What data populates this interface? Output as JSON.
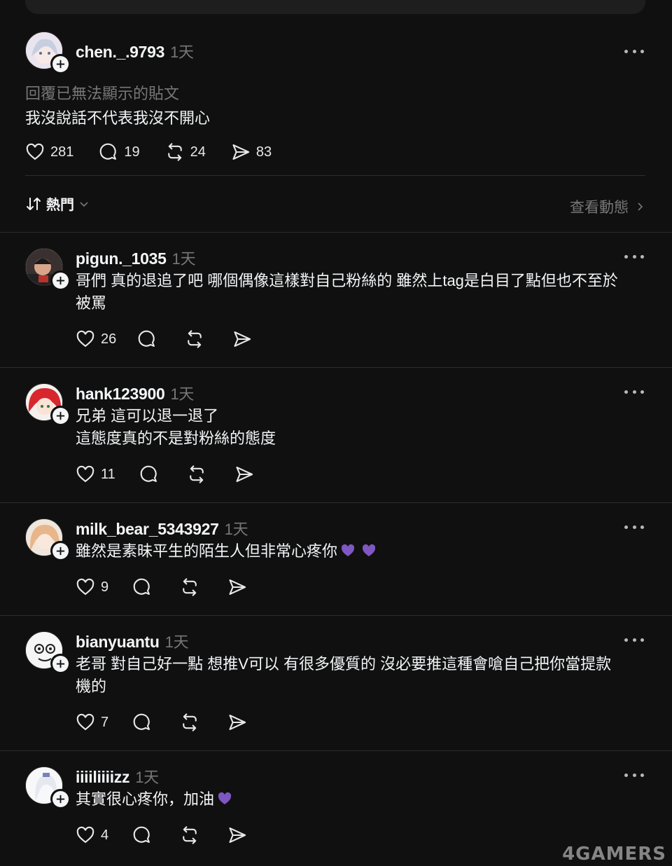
{
  "main_post": {
    "username": "chen._.9793",
    "time": "1天",
    "reply_notice": "回覆已無法顯示的貼文",
    "text": "我沒說話不代表我沒不開心",
    "likes": "281",
    "comments": "19",
    "reposts": "24",
    "shares": "83"
  },
  "sort_bar": {
    "label": "熱門",
    "activity_link": "查看動態"
  },
  "replies": [
    {
      "username": "pigun._1035",
      "time": "1天",
      "text_line1": "哥們 真的退追了吧 哪個偶像這樣對自己粉絲的 雖然上tag是白目了點但也不至於",
      "text_line2": "被罵",
      "likes": "26"
    },
    {
      "username": "hank123900",
      "time": "1天",
      "text_line1": "兄弟 這可以退一退了",
      "text_line2": "這態度真的不是對粉絲的態度",
      "likes": "11"
    },
    {
      "username": "milk_bear_5343927",
      "time": "1天",
      "text_line1": "雖然是素昧平生的陌生人但非常心疼你",
      "likes": "9"
    },
    {
      "username": "bianyuantu",
      "time": "1天",
      "text_line1": "老哥 對自己好一點 想推V可以 有很多優質的 沒必要推這種會嗆自己把你當提款",
      "text_line2": "機的",
      "likes": "7"
    },
    {
      "username": "iiiiliiiizz",
      "time": "1天",
      "text_line1": "其實很心疼你，加油",
      "likes": "4"
    }
  ],
  "watermark": "4GAMERS",
  "colors": {
    "background": "#101010",
    "text_primary": "#f3f5f7",
    "text_secondary": "#777777",
    "divider": "#2c2c2c"
  },
  "icons": [
    "heart-icon",
    "comment-icon",
    "repost-icon",
    "share-icon",
    "more-icon",
    "plus-icon",
    "sort-icon",
    "chevron-down-icon",
    "chevron-right-icon",
    "purple-heart-emoji"
  ]
}
